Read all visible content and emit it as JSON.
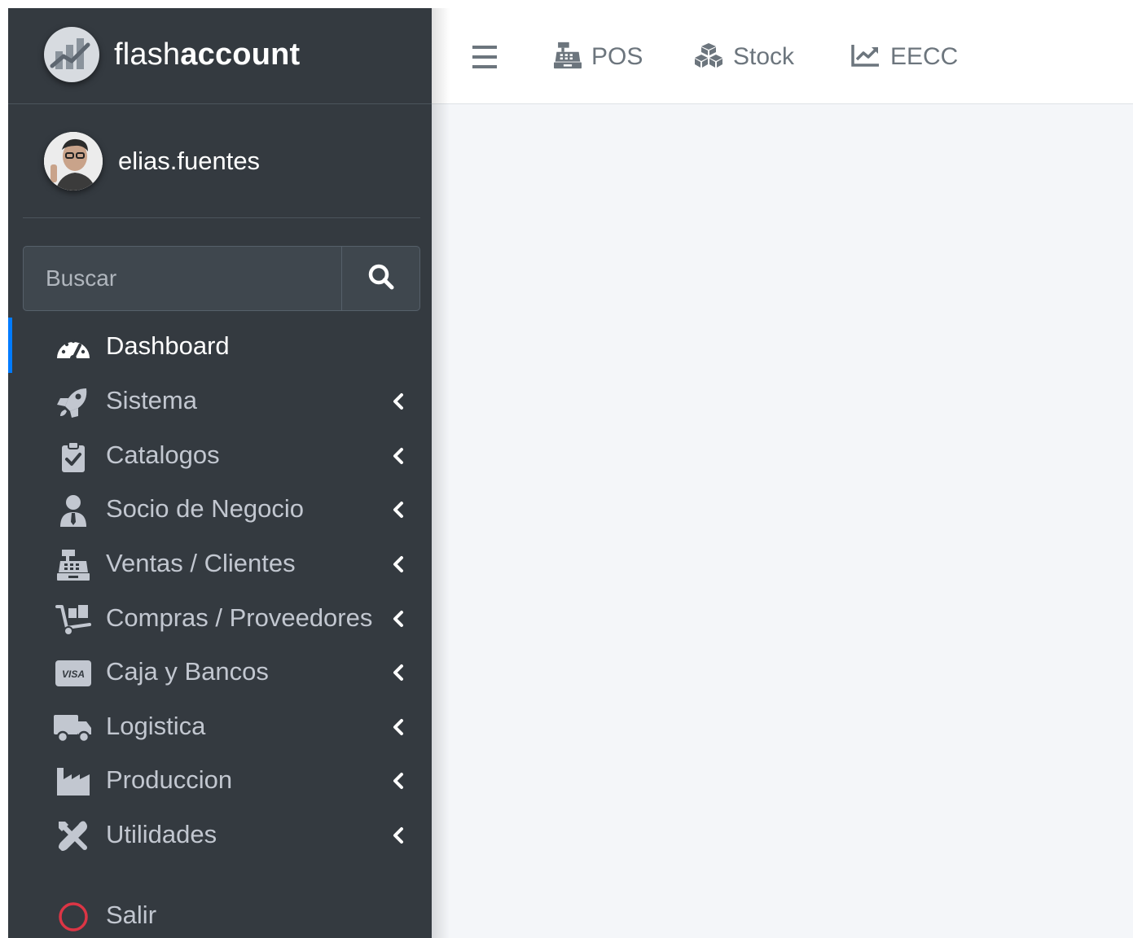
{
  "brand": {
    "name_light": "flash",
    "name_bold": "account"
  },
  "user": {
    "name": "elias.fuentes"
  },
  "search": {
    "placeholder": "Buscar"
  },
  "topbar": {
    "links": [
      {
        "label": "POS",
        "icon": "cash-register-icon"
      },
      {
        "label": "Stock",
        "icon": "cubes-icon"
      },
      {
        "label": "EECC",
        "icon": "chart-line-icon"
      }
    ]
  },
  "sidebar": {
    "items": [
      {
        "label": "Dashboard",
        "icon": "tachometer-icon",
        "active": true
      },
      {
        "label": "Sistema",
        "icon": "rocket-icon"
      },
      {
        "label": "Catalogos",
        "icon": "clipboard-check-icon"
      },
      {
        "label": "Socio de Negocio",
        "icon": "user-tie-icon"
      },
      {
        "label": "Ventas / Clientes",
        "icon": "cash-register-icon"
      },
      {
        "label": "Compras / Proveedores",
        "icon": "dolly-icon"
      },
      {
        "label": "Caja y Bancos",
        "icon": "visa-card-icon",
        "badge": "VISA"
      },
      {
        "label": "Logistica",
        "icon": "truck-icon"
      },
      {
        "label": "Produccion",
        "icon": "industry-icon"
      },
      {
        "label": "Utilidades",
        "icon": "tools-icon"
      }
    ],
    "logout": {
      "label": "Salir",
      "icon": "circle-icon"
    }
  },
  "colors": {
    "sidebar_bg": "#343a40",
    "accent": "#007bff",
    "logout_icon": "#dc3545",
    "content_bg": "#f4f6f9"
  }
}
